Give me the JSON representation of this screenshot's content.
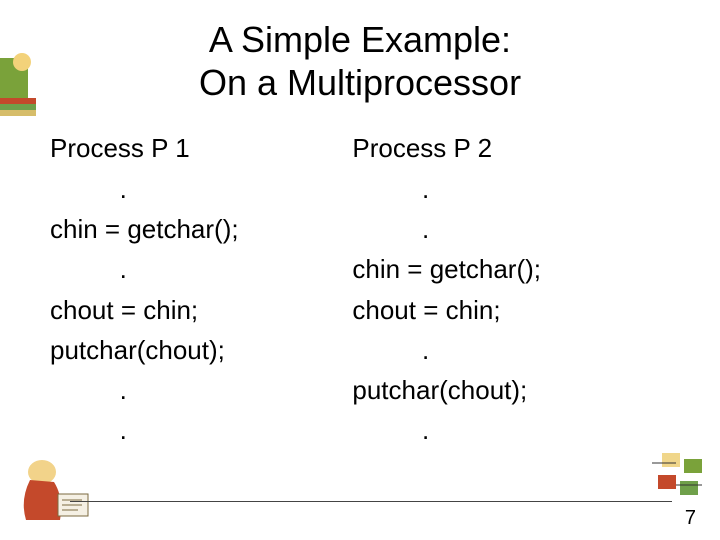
{
  "title_line1": "A Simple Example:",
  "title_line2": "On a Multiprocessor",
  "left": {
    "header": "Process P 1",
    "lines": [
      "   .",
      "chin = getchar();",
      "   .",
      "chout = chin;",
      "putchar(chout);",
      "   .",
      "   ."
    ]
  },
  "right": {
    "header": "Process P 2",
    "lines": [
      "   .",
      "   .",
      "chin = getchar();",
      "chout = chin;",
      "   .",
      "putchar(chout);",
      "   ."
    ]
  },
  "page_number": "7"
}
